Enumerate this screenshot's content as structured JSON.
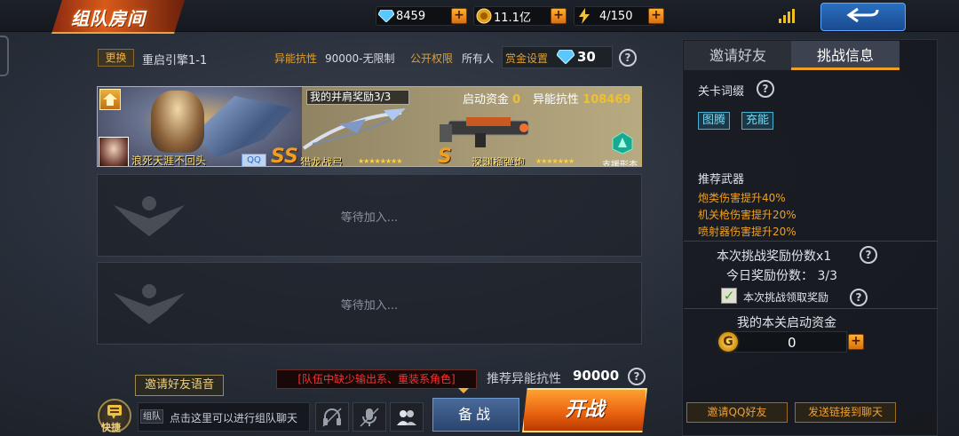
{
  "header": {
    "title": "组队房间",
    "diamonds": "8459",
    "gold": "11.1亿",
    "stamina": "4/150",
    "plus_label": "+"
  },
  "room": {
    "change_label": "更换",
    "stage_name": "重启引擎1-1",
    "resist_label": "异能抗性",
    "resist_value": "90000-无限制",
    "perm_label": "公开权限",
    "perm_value": "所有人",
    "bounty_label": "赏金设置",
    "bounty_value": "30",
    "help_label": "?"
  },
  "slot1": {
    "reward_tag": "我的并肩奖励3/3",
    "start_fund_label": "启动资金",
    "start_fund_value": "0",
    "resist_label": "异能抗性",
    "resist_value": "108469",
    "player_name": "浪死天涯不回头",
    "qq_tag": "QQ",
    "weapon1_grade": "SS",
    "weapon1_name": "猎龙战弓",
    "weapon1_stars": "★★★★★★★★",
    "weapon2_grade": "S",
    "weapon2_name": "深渊榴弹炮",
    "weapon2_stars": "★★★★★★★",
    "support_label": "支援形态"
  },
  "slots": {
    "waiting_text": "等待加入..."
  },
  "bottom": {
    "voice_invite": "邀请好友语音",
    "warning": "[队伍中缺少输出系、重装系角色]",
    "recommend_label": "推荐异能抗性",
    "recommend_value": "90000",
    "quick_label": "快捷",
    "chat_tag": "组队",
    "chat_hint": "点击这里可以进行组队聊天",
    "ready_label": "备战",
    "start_label": "开战"
  },
  "right_panel": {
    "tabs": [
      {
        "label": "邀请好友"
      },
      {
        "label": "挑战信息"
      }
    ],
    "affix_title": "关卡词缀",
    "affixes": [
      "图腾",
      "充能"
    ],
    "weapons_title": "推荐武器",
    "weapon_bonuses": [
      "炮类伤害提升40%",
      "机关枪伤害提升20%",
      "喷射器伤害提升20%"
    ],
    "reward_count": "本次挑战奖励份数x1",
    "today_reward": "今日奖励份数：  3/3",
    "claim_label": "本次挑战领取奖励",
    "my_fund_title": "我的本关启动资金",
    "fund_value": "0",
    "coin_label": "G",
    "invite_qq": "邀请QQ好友",
    "send_link": "发送链接到聊天"
  },
  "colors": {
    "accent_orange": "#f0a020",
    "warning_red": "#ff3030",
    "affix_cyan": "#7ad8f0"
  }
}
